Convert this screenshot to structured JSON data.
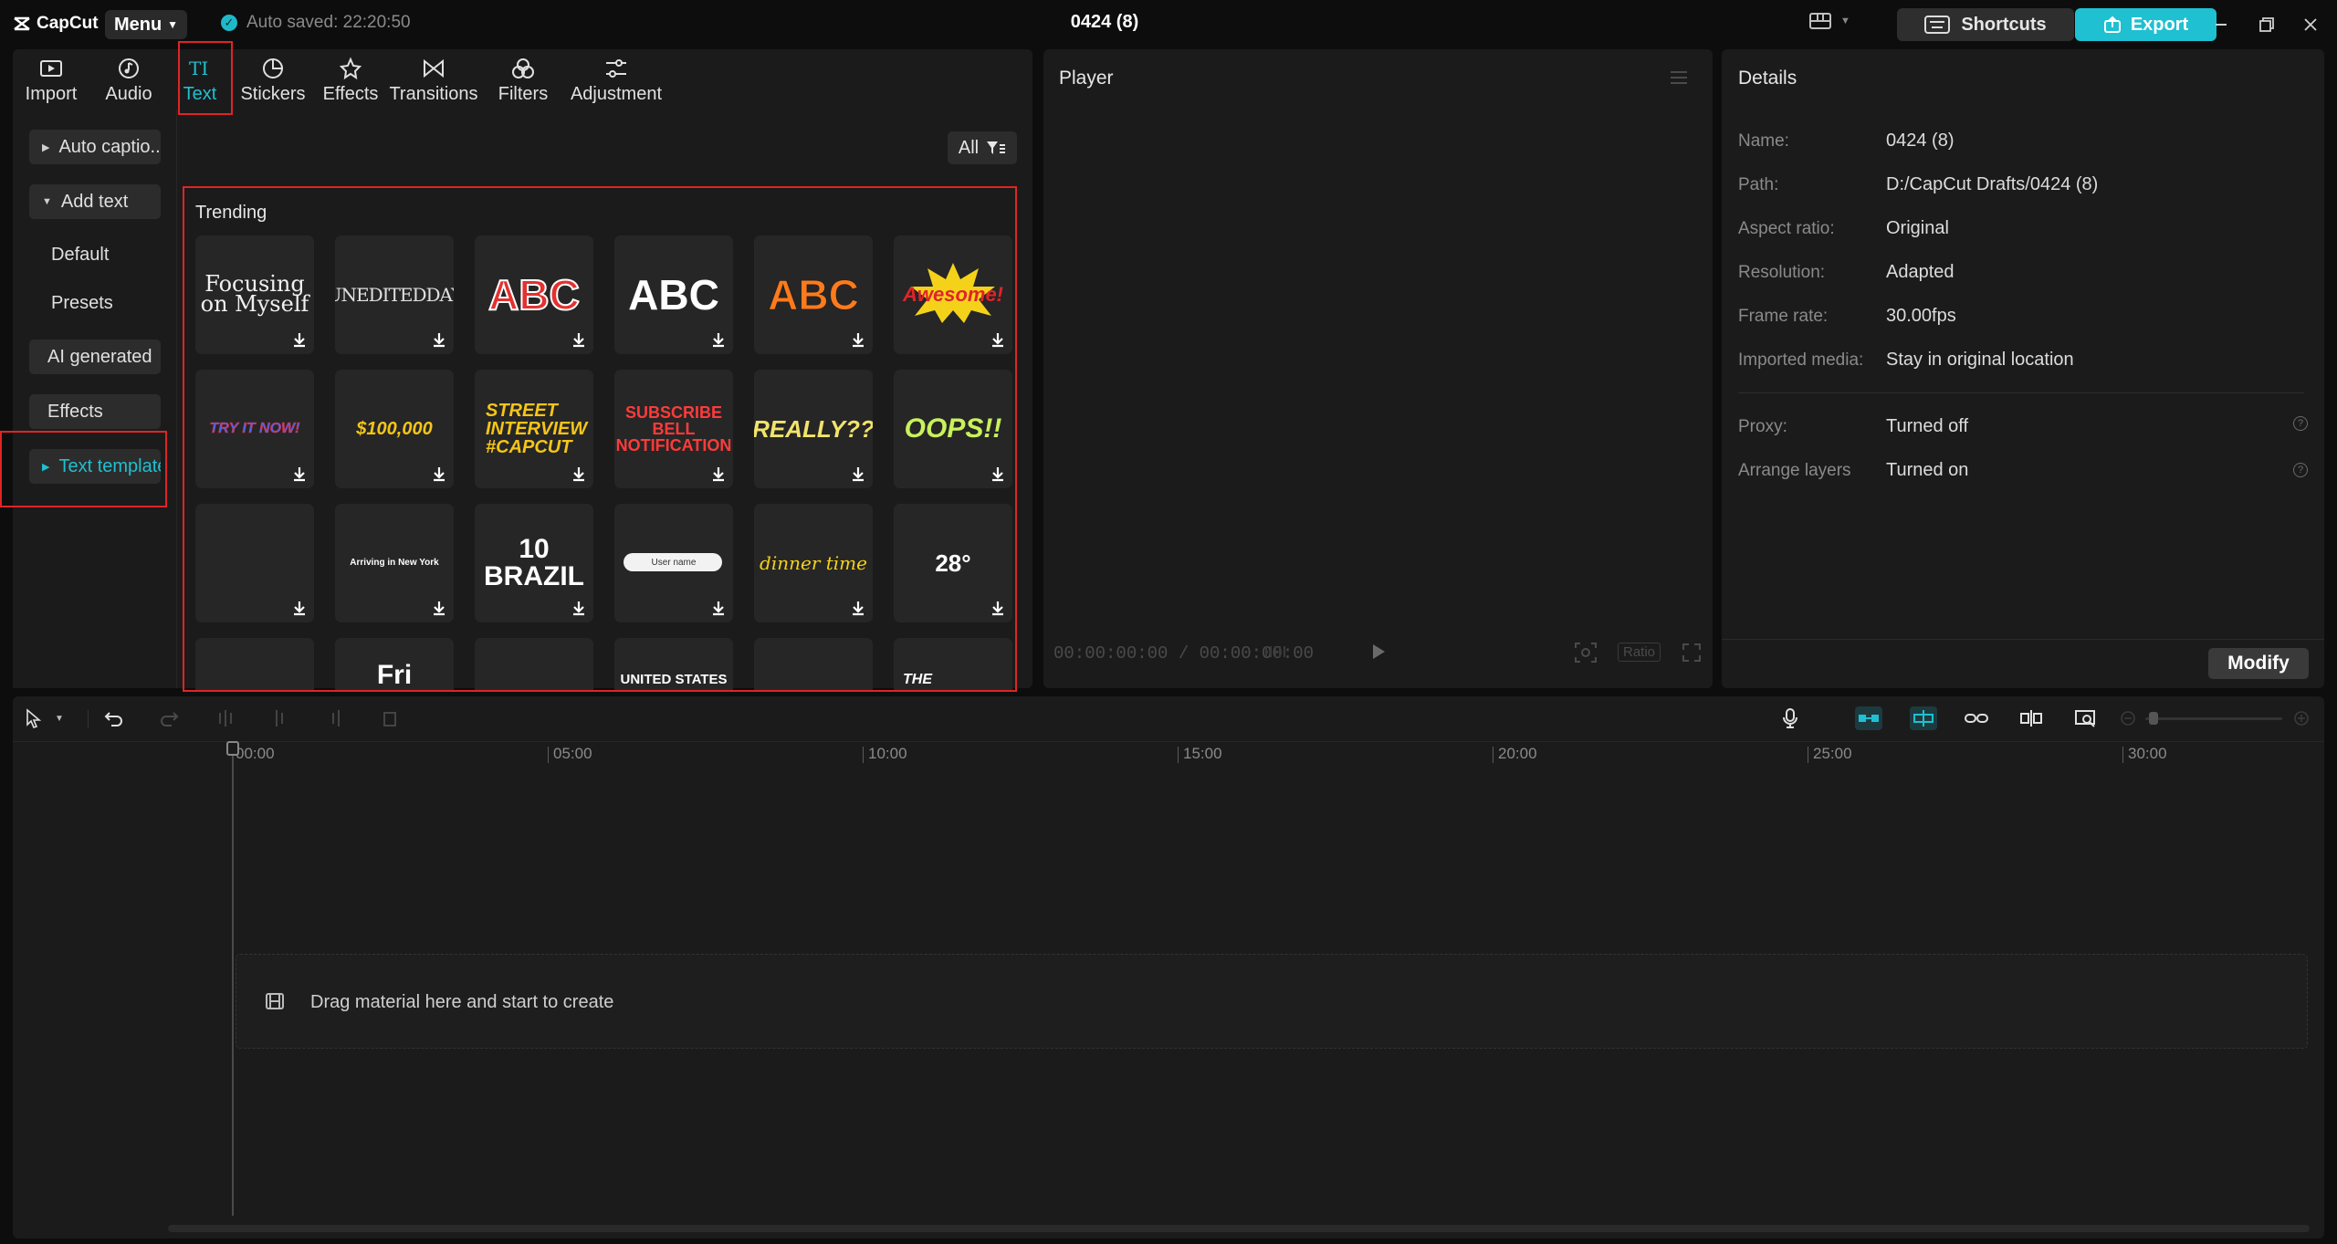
{
  "app": {
    "logo_text": "CapCut",
    "menu_label": "Menu",
    "autosave_text": "Auto saved: 22:20:50",
    "project_title": "0424 (8)",
    "shortcuts_label": "Shortcuts",
    "export_label": "Export"
  },
  "tabs": [
    {
      "label": "Import",
      "icon": "import-icon"
    },
    {
      "label": "Audio",
      "icon": "audio-icon"
    },
    {
      "label": "Text",
      "icon": "text-icon"
    },
    {
      "label": "Stickers",
      "icon": "stickers-icon"
    },
    {
      "label": "Effects",
      "icon": "effects-icon"
    },
    {
      "label": "Transitions",
      "icon": "transitions-icon"
    },
    {
      "label": "Filters",
      "icon": "filters-icon"
    },
    {
      "label": "Adjustment",
      "icon": "adjustment-icon"
    }
  ],
  "sidebar": {
    "auto_captions": "Auto captio...",
    "add_text": "Add text",
    "default": "Default",
    "presets": "Presets",
    "ai_generated": "AI generated",
    "effects": "Effects",
    "text_template": "Text template"
  },
  "content": {
    "filter_label": "All",
    "section_title": "Trending",
    "cards": [
      "Focusing on Myself",
      "UNEDITEDDAY",
      "ABC",
      "ABC",
      "ABC",
      "Awesome!",
      "TRY IT NOW!",
      "$100,000",
      "STREET INTERVIEW #CAPCUT",
      "SUBSCRIBE BELL NOTIFICATION",
      "REALLY??",
      "OOPS!!",
      "",
      "Arriving in New York",
      "10 BRAZIL",
      "User name",
      "dinner time",
      "28°",
      "",
      "Fri",
      "",
      "UNITED STATES",
      "",
      "THE"
    ]
  },
  "player": {
    "title": "Player",
    "timecode": "00:00:00:00 / 00:00:00:00",
    "ratio_label": "Ratio"
  },
  "details": {
    "title": "Details",
    "rows": [
      {
        "label": "Name:",
        "value": "0424 (8)"
      },
      {
        "label": "Path:",
        "value": "D:/CapCut Drafts/0424 (8)"
      },
      {
        "label": "Aspect ratio:",
        "value": "Original"
      },
      {
        "label": "Resolution:",
        "value": "Adapted"
      },
      {
        "label": "Frame rate:",
        "value": "30.00fps"
      },
      {
        "label": "Imported media:",
        "value": "Stay in original location"
      },
      {
        "label": "Proxy:",
        "value": "Turned off"
      },
      {
        "label": "Arrange layers",
        "value": "Turned on"
      }
    ],
    "modify_label": "Modify"
  },
  "timeline": {
    "ruler": [
      "00:00",
      "05:00",
      "10:00",
      "15:00",
      "20:00",
      "25:00",
      "30:00"
    ],
    "drop_text": "Drag material here and start to create"
  },
  "colors": {
    "accent": "#1fc0d1",
    "highlight": "#e02424",
    "panel": "#1b1b1b"
  }
}
